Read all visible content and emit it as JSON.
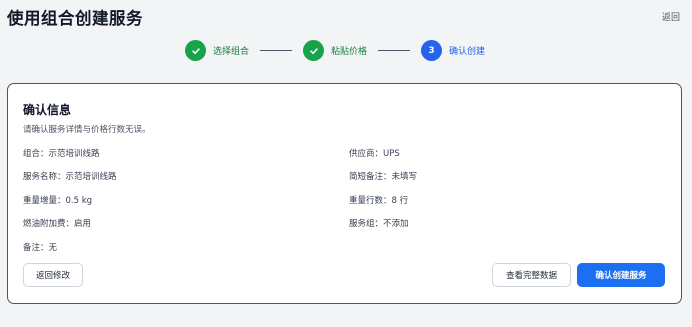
{
  "header": {
    "title": "使用组合创建服务",
    "back_label": "返回"
  },
  "stepper": {
    "steps": [
      {
        "label": "选择组合",
        "status": "done",
        "icon": "check-icon"
      },
      {
        "label": "粘贴价格",
        "status": "done",
        "icon": "check-icon"
      },
      {
        "label": "确认创建",
        "status": "active",
        "number": "3"
      }
    ]
  },
  "card": {
    "title": "确认信息",
    "subtitle": "请确认服务详情与价格行数无误。",
    "fields": {
      "combo": "组合：示范培训线路",
      "supplier": "供应商：UPS",
      "service_name": "服务名称：示范培训线路",
      "short_note": "简短备注：未填写",
      "weight_increment": "重量增量：0.5 kg",
      "weight_rows": "重量行数：8 行",
      "fuel_surcharge": "燃油附加费：启用",
      "service_group": "服务组：不添加",
      "remark": "备注：无"
    },
    "buttons": {
      "back_edit": "返回修改",
      "view_data": "查看完整数据",
      "confirm": "确认创建服务"
    }
  },
  "colors": {
    "done": "#16a34a",
    "active": "#2563eb",
    "primary_button": "#1d6ff2"
  }
}
